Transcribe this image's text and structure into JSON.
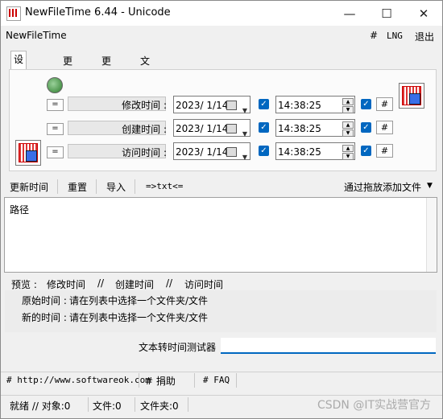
{
  "window": {
    "title": "NewFileTime 6.44 - Unicode",
    "minimize": "—",
    "maximize": "☐",
    "close": "✕"
  },
  "menubar": {
    "app_name": "NewFileTime",
    "hash": "#",
    "lng": "LNG",
    "exit": "退出"
  },
  "tabs": [
    "设置时间",
    "更早些",
    "更晚些",
    "文件名转时间"
  ],
  "rows": [
    {
      "label": "修改时间 :",
      "date": "2023/ 1/14",
      "time": "14:38:25"
    },
    {
      "label": "创建时间 :",
      "date": "2023/ 1/14",
      "time": "14:38:25"
    },
    {
      "label": "访问时间 :",
      "date": "2023/ 1/14",
      "time": "14:38:25"
    }
  ],
  "buttons": {
    "eq": "=",
    "hash": "#"
  },
  "toolbar": {
    "update": "更新时间",
    "reset": "重置",
    "import": "导入",
    "txt": "=>txt<=",
    "add_via_drag": "通过拖放添加文件",
    "dropdown": "▼"
  },
  "list": {
    "header": "路径"
  },
  "preview": {
    "label": "预览 :",
    "modify": "修改时间",
    "sep1": "//",
    "create": "创建时间",
    "sep2": "//",
    "access": "访问时间",
    "original_label": "原始时间 :",
    "original_value": "请在列表中选择一个文件夹/文件",
    "new_label": "新的时间 :",
    "new_value": "请在列表中选择一个文件夹/文件"
  },
  "tester": {
    "label": "文本转时间测试器",
    "value": ""
  },
  "links": {
    "site": "# http://www.softwareok.com",
    "donate": "# 捐助",
    "faq": "# FAQ"
  },
  "status": {
    "ready": "就绪 // 对象:0",
    "files": "文件:0",
    "folders": "文件夹:0"
  },
  "watermark": "CSDN @IT实战营官方"
}
